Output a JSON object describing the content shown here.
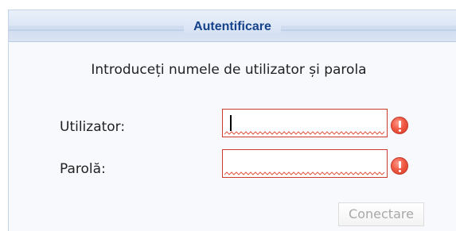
{
  "dialog": {
    "title": "Autentificare",
    "prompt": "Introduceți numele de utilizator și parola"
  },
  "form": {
    "username_label": "Utilizator:",
    "username_value": "",
    "password_label": "Parolă:",
    "password_value": "",
    "submit_label": "Conectare",
    "submit_enabled": false,
    "error_icon": "exclamation-circle-icon",
    "error_color": "#d8391f"
  },
  "colors": {
    "header_text": "#15428b",
    "field_border": "#cc3b2b"
  }
}
